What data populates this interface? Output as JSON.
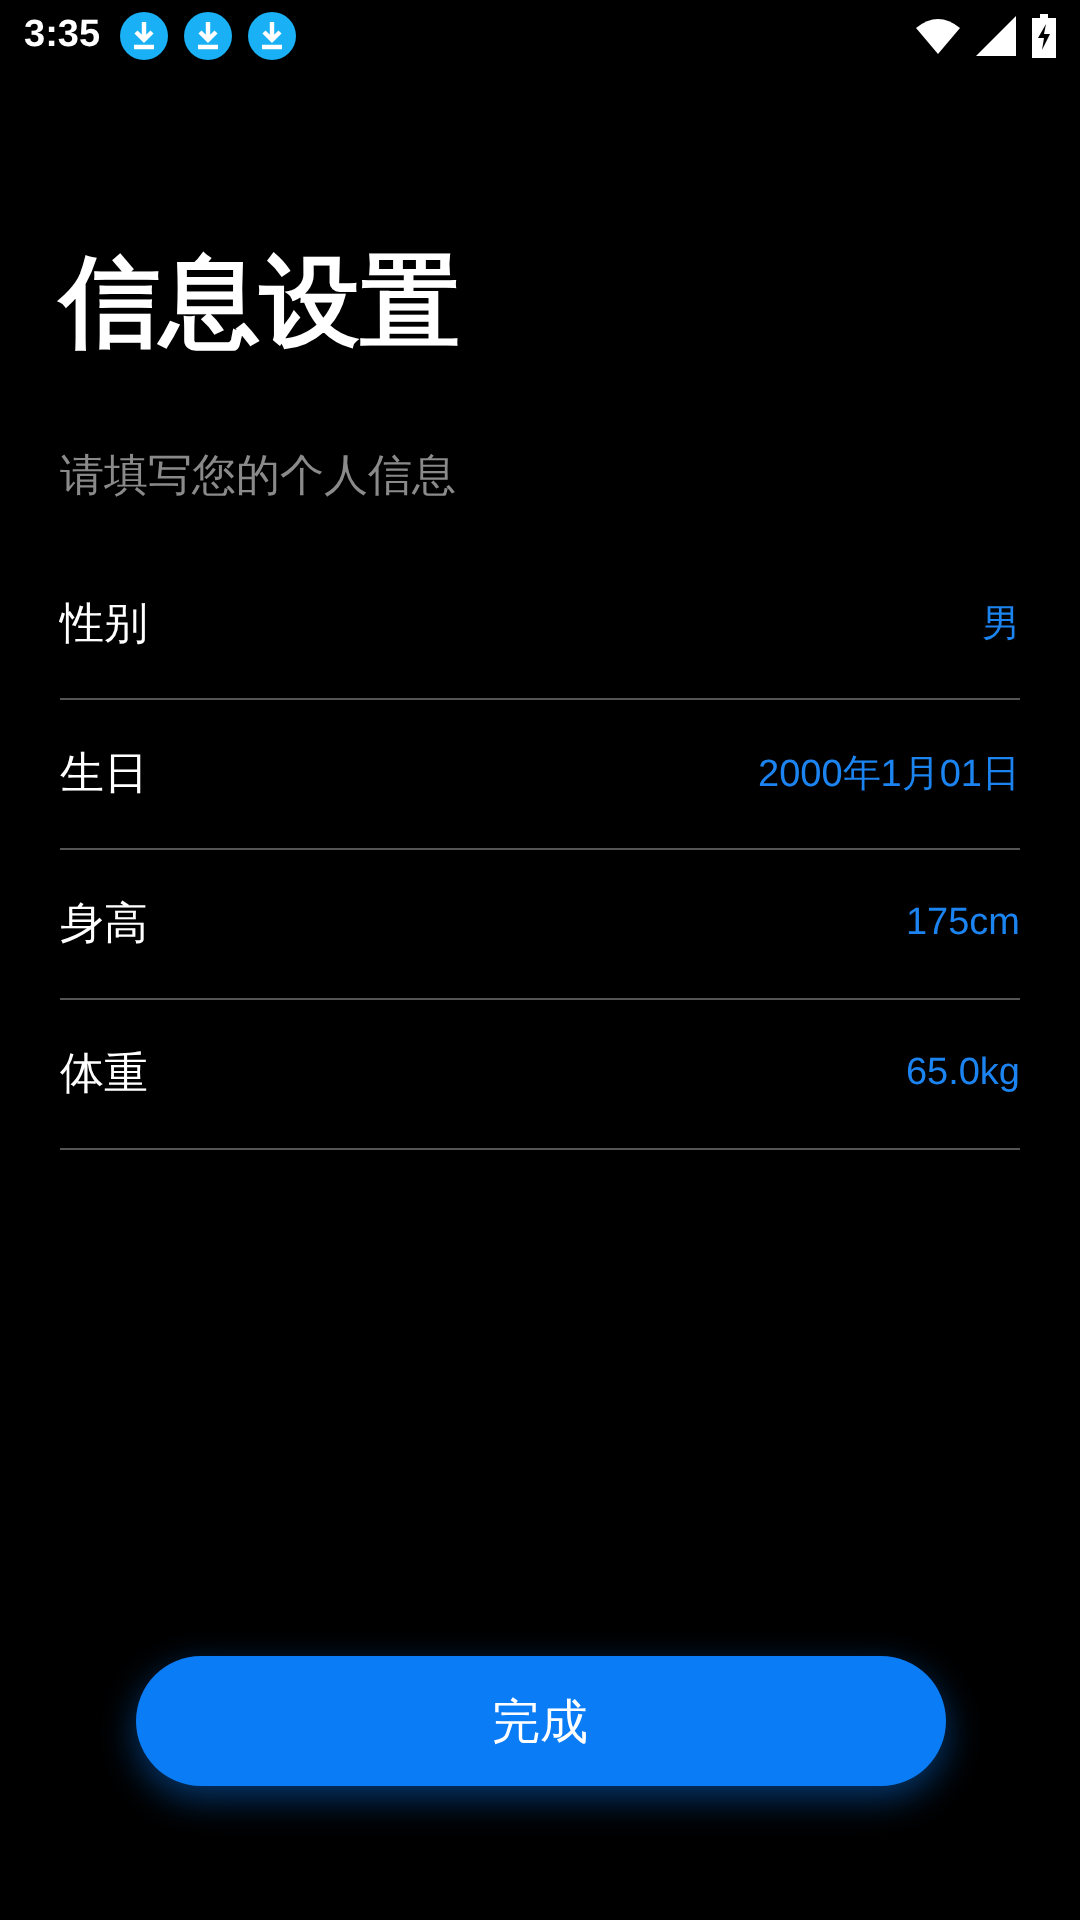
{
  "status_bar": {
    "time": "3:35",
    "notifications": [
      {
        "kind": "download"
      },
      {
        "kind": "download"
      },
      {
        "kind": "download"
      }
    ]
  },
  "title": "信息设置",
  "subtitle": "请填写您的个人信息",
  "fields": [
    {
      "label": "性别",
      "value": "男"
    },
    {
      "label": "生日",
      "value": "2000年1月01日"
    },
    {
      "label": "身高",
      "value": "175cm"
    },
    {
      "label": "体重",
      "value": "65.0kg"
    }
  ],
  "button": "完成"
}
